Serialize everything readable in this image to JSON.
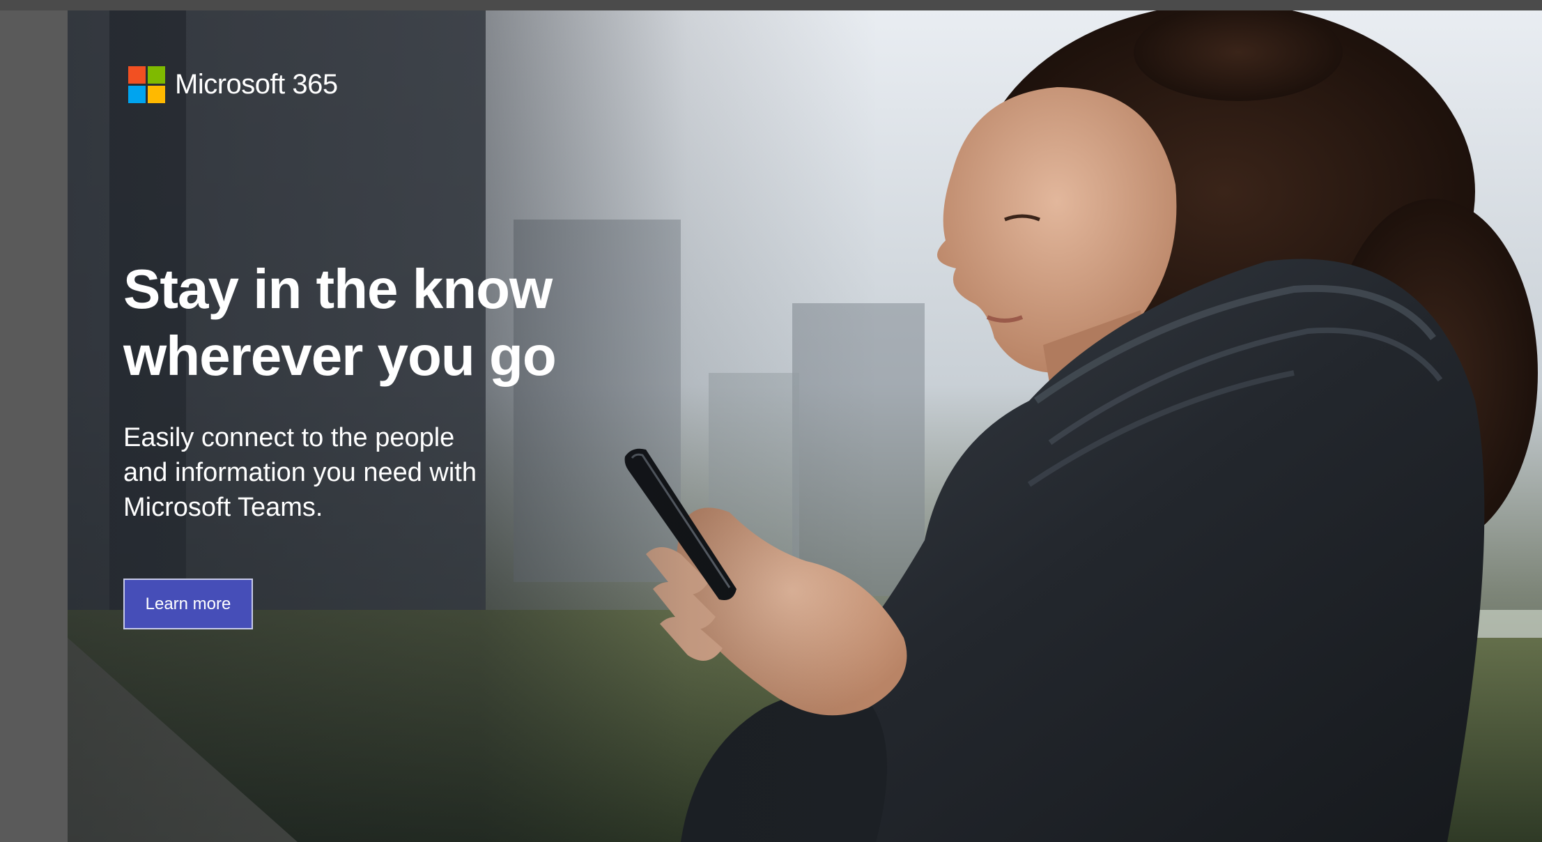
{
  "brand": {
    "name": "Microsoft 365",
    "logo_colors": [
      "#f25022",
      "#7fba00",
      "#00a4ef",
      "#ffb900"
    ]
  },
  "hero": {
    "headline_line1": "Stay in the know",
    "headline_line2": "wherever you go",
    "subcopy_line1": "Easily connect to the people",
    "subcopy_line2": "and information you need with",
    "subcopy_line3": "Microsoft Teams.",
    "cta_label": "Learn more",
    "cta_color": "#464eb8"
  },
  "photo": {
    "subject": "woman-in-dark-puffer-jacket-looking-at-phone-icon"
  }
}
